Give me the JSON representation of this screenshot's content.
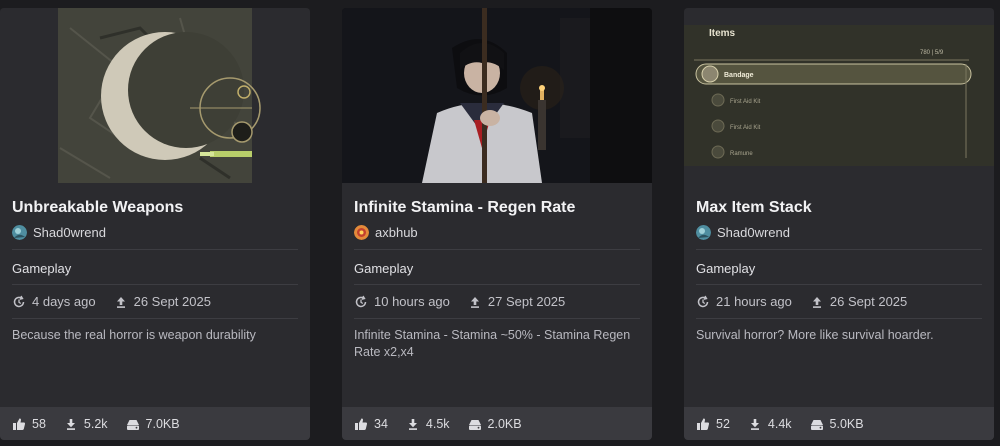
{
  "cards": [
    {
      "title": "Unbreakable Weapons",
      "author": "Shad0wrend",
      "category": "Gameplay",
      "updated": "4 days ago",
      "uploaded": "26 Sept 2025",
      "description": "Because the real horror is weapon durability",
      "likes": "58",
      "downloads": "5.2k",
      "size": "7.0KB"
    },
    {
      "title": "Infinite Stamina - Regen Rate",
      "author": "axbhub",
      "category": "Gameplay",
      "updated": "10 hours ago",
      "uploaded": "27 Sept 2025",
      "description": "Infinite Stamina - Stamina ~50% - Stamina Regen Rate x2,x4",
      "likes": "34",
      "downloads": "4.5k",
      "size": "2.0KB"
    },
    {
      "title": "Max Item Stack",
      "author": "Shad0wrend",
      "category": "Gameplay",
      "updated": "21 hours ago",
      "uploaded": "26 Sept 2025",
      "description": "Survival horror? More like survival hoarder.",
      "likes": "52",
      "downloads": "4.4k",
      "size": "5.0KB"
    }
  ],
  "thumb3": {
    "header": "Items",
    "counter": "780 | 5/9",
    "items": [
      "Bandage",
      "First Aid Kit",
      "First Aid Kit",
      "Ramune"
    ]
  },
  "icons": {
    "updated": "clock-refresh-icon",
    "uploaded": "upload-icon",
    "likes": "thumbs-up-icon",
    "downloads": "download-icon",
    "size": "storage-icon"
  }
}
